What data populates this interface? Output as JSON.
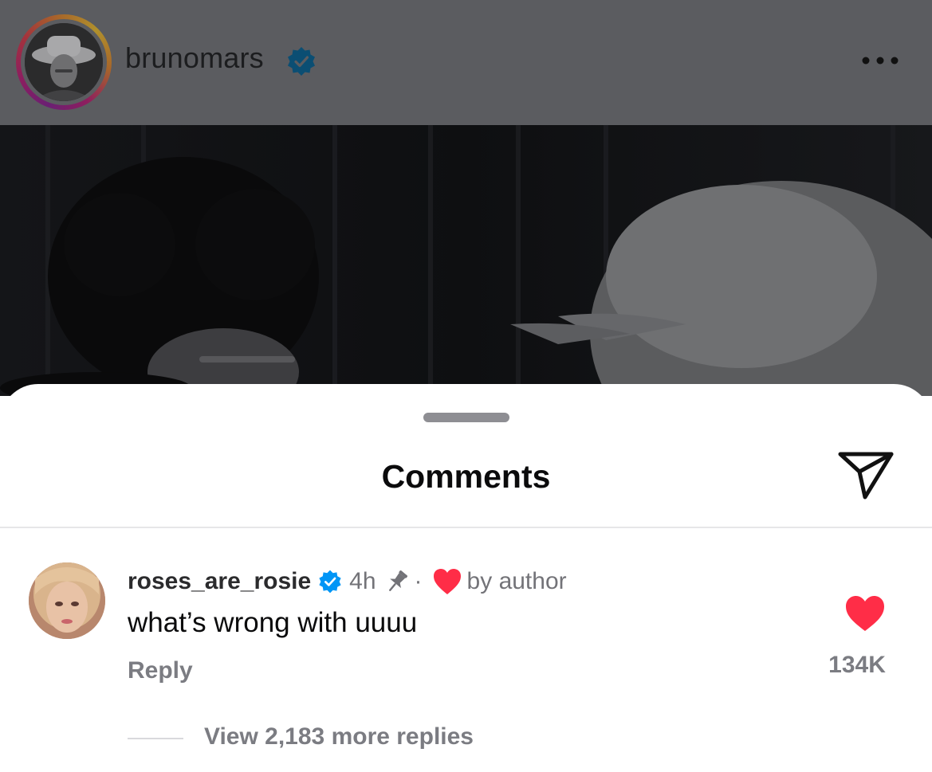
{
  "post": {
    "username": "brunomars",
    "author_avatar_icon": "profile-photo",
    "verified_icon": "verified-badge-icon",
    "more_icon": "more-dots-icon",
    "story_ring_colors": [
      "#6a1f73",
      "#a3333c",
      "#b0902c"
    ]
  },
  "comments_sheet": {
    "title": "Comments",
    "share_icon": "paper-plane-icon"
  },
  "comment": {
    "username": "roses_are_rosie",
    "time": "4h",
    "separator": "·",
    "pinned_icon": "pin-icon",
    "author_liked_icon": "heart-icon",
    "author_liked_label": "by author",
    "text": "what’s wrong with uuuu",
    "reply_label": "Reply",
    "like_count": "134K",
    "liked": true,
    "like_color": "#ff2d47",
    "view_replies_label": "View 2,183 more replies"
  },
  "colors": {
    "verified_blue": "#0095f6",
    "muted_text": "#737378",
    "dimmed_header": "#5b5c60"
  }
}
